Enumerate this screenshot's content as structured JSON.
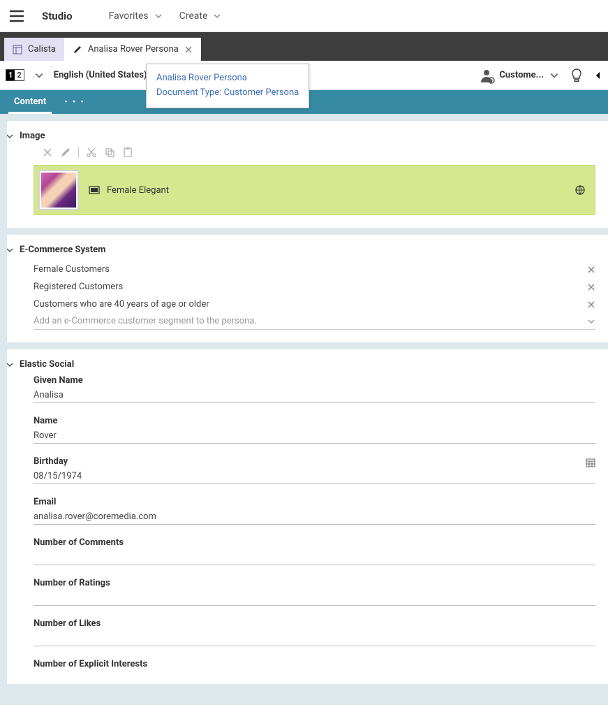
{
  "header": {
    "app_title": "Studio",
    "menu": {
      "favorites": "Favorites",
      "create": "Create"
    }
  },
  "tabs": [
    {
      "label": "Calista",
      "icon": "dashboard-icon",
      "bg": "lilac",
      "closable": false
    },
    {
      "label": "Analisa Rover Persona",
      "icon": "pencil-icon",
      "bg": "white",
      "closable": true
    }
  ],
  "tooltip": {
    "line1": "Analisa Rover Persona",
    "line2": "Document Type: Customer Persona"
  },
  "infobar": {
    "lang_toggle": {
      "active": "1",
      "inactive": "2"
    },
    "locale": "English (United States)",
    "customer_label": "Custome..."
  },
  "content_tab": {
    "content": "Content",
    "more": "• • •"
  },
  "image_panel": {
    "title": "Image",
    "item_label": "Female Elegant"
  },
  "ecommerce_panel": {
    "title": "E-Commerce System",
    "segments": [
      "Female Customers",
      "Registered Customers",
      "Customers who are 40 years of age or older"
    ],
    "add_placeholder": "Add an e-Commerce customer segment to the persona."
  },
  "elastic_panel": {
    "title": "Elastic Social",
    "fields": {
      "given_name": {
        "label": "Given Name",
        "value": "Analisa"
      },
      "name": {
        "label": "Name",
        "value": "Rover"
      },
      "birthday": {
        "label": "Birthday",
        "value": "08/15/1974"
      },
      "email": {
        "label": "Email",
        "value": "analisa.rover@coremedia.com"
      },
      "num_comments": {
        "label": "Number of Comments",
        "value": ""
      },
      "num_ratings": {
        "label": "Number of Ratings",
        "value": ""
      },
      "num_likes": {
        "label": "Number of Likes",
        "value": ""
      },
      "num_interests": {
        "label": "Number of Explicit Interests",
        "value": ""
      }
    }
  }
}
